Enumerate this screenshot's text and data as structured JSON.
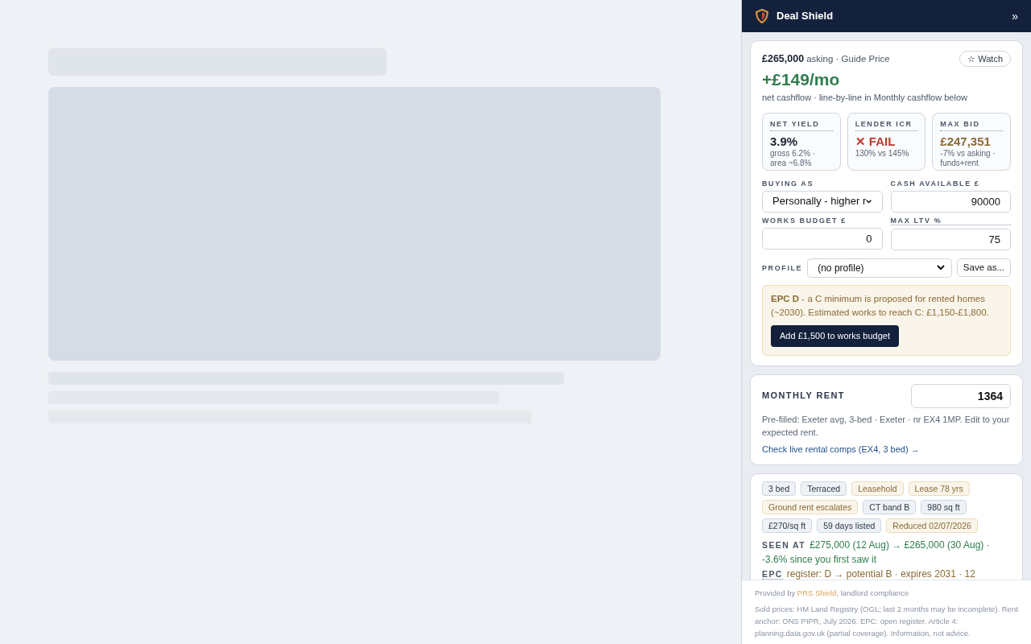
{
  "panel": {
    "title": "Deal Shield",
    "collapse": "»"
  },
  "summary": {
    "asking_price": "£265,000",
    "asking_label": "asking · Guide Price",
    "watch_label": "☆ Watch",
    "cashflow": "+£149/mo",
    "cashflow_note": "net cashflow · line-by-line in Monthly cashflow below",
    "metrics": [
      {
        "label": "NET YIELD",
        "value": "3.9%",
        "note": "gross 6.2% · area ~6.8%",
        "kind": "neutral"
      },
      {
        "label": "LENDER ICR",
        "value": "✕ FAIL",
        "note": "130% vs 145%",
        "kind": "fail"
      },
      {
        "label": "MAX BID",
        "value": "£247,351",
        "note": "-7% vs asking · funds+rent",
        "kind": "bid"
      }
    ],
    "fields": [
      {
        "label": "BUYING AS",
        "kind": "select",
        "value": "Personally - higher r"
      },
      {
        "label": "CASH AVAILABLE £",
        "kind": "input",
        "value": "90000"
      },
      {
        "label": "WORKS BUDGET £",
        "kind": "input",
        "value": "0"
      },
      {
        "label": "MAX LTV %",
        "kind": "input",
        "value": "75",
        "hint": true
      }
    ],
    "profile": {
      "label": "PROFILE",
      "value": "(no profile)",
      "save_label": "Save as..."
    },
    "epc_notice": {
      "text": "**EPC D** - a C minimum is proposed for rented homes (~2030). Estimated works to reach C: £1,150-£1,800.",
      "action": "Add £1,500 to works budget"
    }
  },
  "rent": {
    "label": "MONTHLY RENT",
    "value": "1364",
    "note": "Pre-filled: Exeter avg, 3-bed · Exeter · nr EX4 1MP. Edit to your expected rent.",
    "link": "Check live rental comps (EX4, 3 bed) →"
  },
  "details": {
    "tags": [
      {
        "text": "3 bed",
        "kind": "neutral"
      },
      {
        "text": "Terraced",
        "kind": "neutral"
      },
      {
        "text": "Leasehold",
        "kind": "warn"
      },
      {
        "text": "Lease 78 yrs",
        "kind": "warn"
      },
      {
        "text": "Ground rent escalates",
        "kind": "warn"
      },
      {
        "text": "CT band B",
        "kind": "neutral"
      },
      {
        "text": "980 sq ft",
        "kind": "neutral"
      },
      {
        "text": "£270/sq ft",
        "kind": "neutral"
      },
      {
        "text": "59 days listed",
        "kind": "neutral"
      },
      {
        "text": "Reduced 02/07/2026",
        "kind": "warn"
      }
    ],
    "facts": [
      {
        "label": "SEEN AT",
        "text": "£275,000 (12 Aug) → £265,000 (30 Aug) · -3.6% since you first saw it",
        "kind": "good"
      },
      {
        "label": "EPC",
        "text": "register: D → potential B · expires 2031 · 12",
        "kind": "warn"
      }
    ]
  },
  "footer": {
    "provided_prefix": "Provided by",
    "provider": "PRS Shield",
    "provided_suffix": ", landlord compliance",
    "sources": "Sold prices: HM Land Registry (OGL; last 2 months may be incomplete). Rent anchor: ONS PIPR, July 2026. EPC: open register. Article 4: planning.data.gov.uk (partial coverage). Information, not advice."
  }
}
